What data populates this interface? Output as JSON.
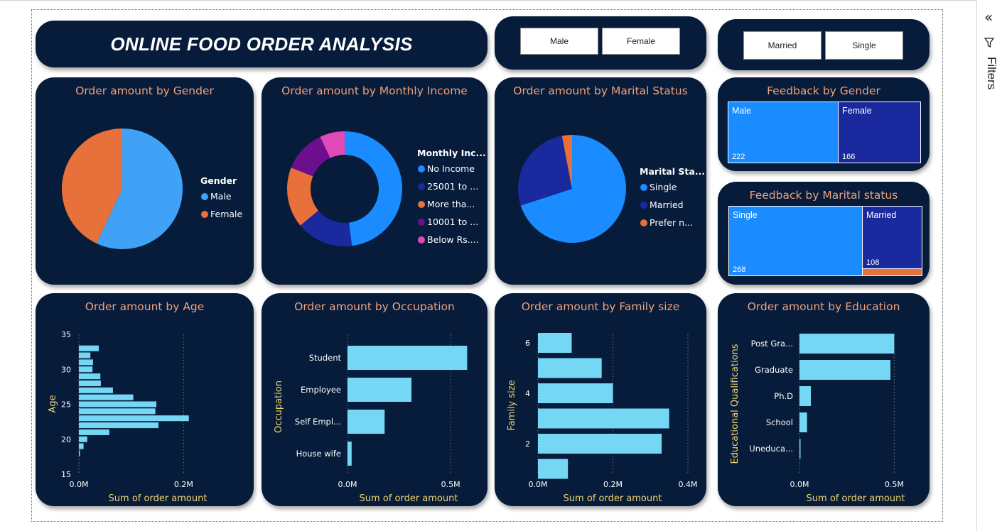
{
  "dashboard": {
    "title": "ONLINE FOOD ORDER ANALYSIS"
  },
  "slicers": {
    "gender": [
      "Male",
      "Female"
    ],
    "marital": [
      "Married",
      "Single"
    ]
  },
  "sidebar": {
    "filters_label": "Filters",
    "collapse_icon": "double-chevron-left-icon",
    "filter_icon": "funnel-icon"
  },
  "colors": {
    "card_bg": "#061c3a",
    "title_orange": "#f2a07b",
    "axis_yellow": "#f1d36b",
    "bar_cyan": "#76d7f5",
    "blue_light": "#3fa2f6",
    "blue_mid": "#1a8cff",
    "navy": "#1a2a9e",
    "orange": "#e8703a",
    "purple": "#6b0f8e",
    "pink": "#e04ab6"
  },
  "cards": {
    "gender_pie": {
      "title": "Order amount by Gender",
      "legend_title": "Gender",
      "legend": [
        "Male",
        "Female"
      ]
    },
    "income_donut": {
      "title": "Order amount by Monthly Income",
      "legend_title": "Monthly Inc...",
      "legend": [
        "No Income",
        "25001 to ...",
        "More tha...",
        "10001 to ...",
        "Below Rs...."
      ]
    },
    "marital_pie": {
      "title": "Order amount by Marital Status",
      "legend_title": "Marital Sta...",
      "legend": [
        "Single",
        "Married",
        "Prefer n..."
      ]
    },
    "feedback_gender": {
      "title": "Feedback by Gender",
      "cells": [
        {
          "label": "Male",
          "value": "222"
        },
        {
          "label": "Female",
          "value": "166"
        }
      ]
    },
    "feedback_marital": {
      "title": "Feedback by Marital status",
      "cells": [
        {
          "label": "Single",
          "value": "268"
        },
        {
          "label": "Married",
          "value": "108"
        }
      ]
    },
    "age": {
      "title": "Order amount by Age",
      "xlabel": "Sum of order amount",
      "ylabel": "Age"
    },
    "occupation": {
      "title": "Order amount by Occupation",
      "xlabel": "Sum of order amount",
      "ylabel": "Occupation"
    },
    "family": {
      "title": "Order amount by Family size",
      "xlabel": "Sum of order amount",
      "ylabel": "Family size"
    },
    "education": {
      "title": "Order amount by Education",
      "xlabel": "Sum of order amount",
      "ylabel": "Educational Qualifications"
    }
  },
  "chart_data": [
    {
      "id": "gender",
      "type": "pie",
      "title": "Order amount by Gender",
      "categories": [
        "Male",
        "Female"
      ],
      "values": [
        57,
        43
      ],
      "colors": [
        "#3fa2f6",
        "#e8703a"
      ]
    },
    {
      "id": "income",
      "type": "pie",
      "title": "Order amount by Monthly Income",
      "categories": [
        "No Income",
        "25001 to ...",
        "More tha...",
        "10001 to ...",
        "Below Rs...."
      ],
      "values": [
        48,
        16,
        17,
        12,
        7
      ],
      "colors": [
        "#1a8cff",
        "#1a2a9e",
        "#e8703a",
        "#6b0f8e",
        "#e04ab6"
      ]
    },
    {
      "id": "marital",
      "type": "pie",
      "title": "Order amount by Marital Status",
      "categories": [
        "Single",
        "Married",
        "Prefer n..."
      ],
      "values": [
        70,
        27,
        3
      ],
      "colors": [
        "#1a8cff",
        "#1a2a9e",
        "#e8703a"
      ]
    },
    {
      "id": "age",
      "type": "bar",
      "title": "Order amount by Age",
      "xlabel": "Sum of order amount",
      "ylabel": "Age",
      "categories": [
        18,
        19,
        20,
        21,
        22,
        23,
        24,
        25,
        26,
        27,
        28,
        29,
        30,
        31,
        32,
        33
      ],
      "values": [
        0.001,
        0.009,
        0.016,
        0.058,
        0.152,
        0.21,
        0.146,
        0.148,
        0.104,
        0.065,
        0.042,
        0.041,
        0.026,
        0.027,
        0.022,
        0.038
      ],
      "xlim": [
        0,
        0.3
      ],
      "ylim": [
        15,
        35
      ],
      "xticks": [
        "0.0M",
        "0.2M"
      ],
      "yticks": [
        15,
        20,
        25,
        30,
        35
      ]
    },
    {
      "id": "occupation",
      "type": "bar",
      "title": "Order amount by Occupation",
      "xlabel": "Sum of order amount",
      "ylabel": "Occupation",
      "categories": [
        "Student",
        "Employee",
        "Self Empl...",
        "House wife"
      ],
      "values": [
        0.58,
        0.31,
        0.18,
        0.02
      ],
      "xlim": [
        0,
        0.6
      ],
      "xticks": [
        "0.0M",
        "0.5M"
      ]
    },
    {
      "id": "family",
      "type": "bar",
      "title": "Order amount by Family size",
      "xlabel": "Sum of order amount",
      "ylabel": "Family size",
      "categories": [
        6,
        5,
        4,
        3,
        2,
        1
      ],
      "values": [
        0.09,
        0.17,
        0.2,
        0.35,
        0.33,
        0.08
      ],
      "xlim": [
        0,
        0.45
      ],
      "xticks": [
        "0.0M",
        "0.2M",
        "0.4M"
      ],
      "yticks": [
        6,
        4,
        2
      ]
    },
    {
      "id": "education",
      "type": "bar",
      "title": "Order amount by Education",
      "xlabel": "Sum of order amount",
      "ylabel": "Educational Qualifications",
      "categories": [
        "Post Gra...",
        "Graduate",
        "Ph.D",
        "School",
        "Uneduca..."
      ],
      "values": [
        0.5,
        0.48,
        0.06,
        0.04,
        0.005
      ],
      "xlim": [
        0,
        0.6
      ],
      "xticks": [
        "0.0M",
        "0.5M"
      ]
    }
  ]
}
